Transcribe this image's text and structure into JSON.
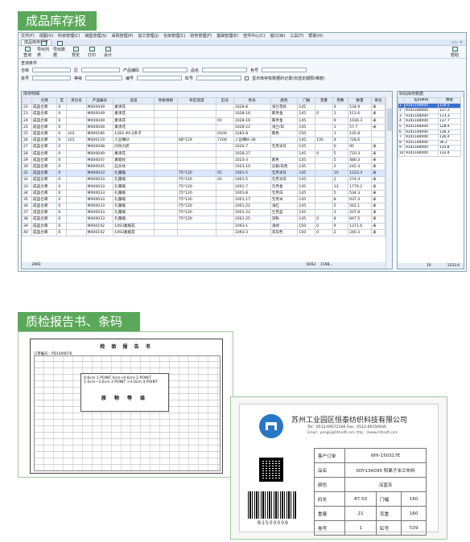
{
  "section1_title": "成品库存报表",
  "section2_title": "质检报告书、条码标签",
  "app": {
    "menu": [
      "文件(F)",
      "视图(V)",
      "科目管理(C)",
      "销售管理(S)",
      "采购管理(P)",
      "加工管理(J)",
      "仓库管理(C)",
      "财务管理(F)",
      "基础管理(E)",
      "控件中心(C)",
      "窗口(W)",
      "工具(T)",
      "帮助(H)"
    ],
    "tab": "成品库存报表",
    "tab_right": "◁ ▷ ✕",
    "toolbar": [
      "查询",
      "导出列表",
      "导出数据",
      "预览",
      "打印",
      "设计"
    ],
    "help_label": "帮助",
    "filter_group": "查询条件",
    "filters": {
      "warehouse": "仓库",
      "zone": "区",
      "product": "产品编码",
      "name": "品名",
      "color_no": "色号",
      "lot": "批号",
      "grade": "等级",
      "serial": "编号",
      "vat": "缸号",
      "checkbox": "显示库存有数据的记录(仅选定期限/维度)"
    },
    "grid_title": "库存明细",
    "side_title": "缸码库存数据"
  },
  "grid": {
    "columns": [
      "",
      "仓库",
      "区",
      "货位号",
      "产品编号",
      "品名",
      "色板规格",
      "布匹宽度",
      "缸号",
      "色号",
      "颜色",
      "门幅",
      "克重",
      "卷数",
      "数量",
      "单位"
    ],
    "rows": [
      [
        "22",
        "成品仓库",
        "0",
        "",
        "M000049",
        "素涤花",
        "",
        "",
        "",
        "1028-8",
        "浅兰花纹",
        "145",
        "",
        "4",
        "534.9",
        "米"
      ],
      [
        "23",
        "成品仓库",
        "0",
        "",
        "M000049",
        "素涤花",
        "",
        "",
        "",
        "1028-16",
        "黄月金",
        "145",
        "0",
        "1",
        "113.6",
        "米"
      ],
      [
        "24",
        "成品仓库",
        "0",
        "",
        "M000049",
        "素涤花",
        "",
        "",
        "01",
        "1028-16",
        "黄月金",
        "145",
        "",
        "9",
        "1036.3",
        "米"
      ],
      [
        "25",
        "成品仓库",
        "0",
        "",
        "M000049",
        "素涤花",
        "",
        "",
        "",
        "1028-22",
        "浅兰/白",
        "145",
        "",
        "1",
        "57.7",
        "米"
      ],
      [
        "25",
        "成品仓库",
        "0",
        "L01",
        "M000186",
        "1283 #0.2条子",
        "",
        "",
        "0100",
        "1283-8",
        "黄色",
        "150",
        "",
        "1",
        "135.8",
        ""
      ],
      [
        "26",
        "成品仓库",
        "0",
        "L01",
        "M000119",
        "人丝细纱",
        "",
        "68*129",
        "7200",
        "人丝细纱-36",
        "",
        "145",
        "130",
        "4",
        "728.6",
        ""
      ],
      [
        "27",
        "成品仓库",
        "0",
        "",
        "M000048",
        "凸纹力织",
        "",
        "",
        "",
        "1026-7",
        "元月冰灰",
        "145",
        "",
        "0",
        "95",
        "米"
      ],
      [
        "28",
        "成品仓库",
        "0",
        "",
        "M000049",
        "素涤花",
        "",
        "",
        "",
        "1028-27",
        "",
        "145",
        "0",
        "5",
        "710.3",
        "米"
      ],
      [
        "29",
        "成品仓库",
        "0",
        "",
        "M000047",
        "素缎纹",
        "",
        "",
        "",
        "1023-3",
        "紫色",
        "145",
        "",
        "5",
        "480.3",
        "米"
      ],
      [
        "30",
        "成品仓库",
        "0",
        "",
        "M000045",
        "石头纹",
        "",
        "",
        "",
        "1023-10",
        "淡紫/白色",
        "145",
        "",
        "2",
        "242.4",
        "米"
      ],
      [
        "31",
        "成品仓库",
        "0",
        "",
        "M000033",
        "礼服缎",
        "",
        "75*120",
        "01",
        "1001-5",
        "元月冰灰",
        "145",
        "",
        "10",
        "1233.4",
        "米"
      ],
      [
        "32",
        "成品仓库",
        "0",
        "",
        "M000033",
        "礼服缎",
        "",
        "75*120",
        "02",
        "1001-5",
        "元月冰灰",
        "145",
        "",
        "2",
        "274.4",
        "米"
      ],
      [
        "33",
        "成品仓库",
        "0",
        "",
        "M000033",
        "礼服缎",
        "",
        "75*120",
        "",
        "1001-7",
        "元月金",
        "145",
        "",
        "13",
        "1770.2",
        "米"
      ],
      [
        "34",
        "成品仓库",
        "0",
        "",
        "M000033",
        "礼服缎",
        "",
        "75*120",
        "",
        "1001-8",
        "元月白",
        "145",
        "",
        "5",
        "534.3",
        "米"
      ],
      [
        "35",
        "成品仓库",
        "0",
        "",
        "M000033",
        "礼服缎",
        "",
        "75*120",
        "",
        "1001-17",
        "元月米",
        "145",
        "",
        "8",
        "937.4",
        "米"
      ],
      [
        "36",
        "成品仓库",
        "0",
        "",
        "M000033",
        "礼服缎",
        "",
        "75*120",
        "",
        "1001-21",
        "浅红",
        "145",
        "",
        "5",
        "562.1",
        "米"
      ],
      [
        "37",
        "成品仓库",
        "0",
        "",
        "M000033",
        "礼服缎",
        "",
        "75*120",
        "",
        "1001-22",
        "兰月蓝",
        "145",
        "",
        "3",
        "207.8",
        "米"
      ],
      [
        "38",
        "成品仓库",
        "0",
        "",
        "M000033",
        "礼服缎",
        "",
        "75*120",
        "",
        "1001-25",
        "深粉",
        "145",
        "0",
        "8",
        "847.5",
        "米"
      ],
      [
        "39",
        "成品仓库",
        "0",
        "",
        "M000192",
        "1093素缎花",
        "",
        "",
        "",
        "1093-1",
        "浅绿",
        "150",
        "0",
        "9",
        "1371.6",
        "米"
      ],
      [
        "40",
        "成品仓库",
        "0",
        "",
        "M000192",
        "1093素缎花",
        "",
        "",
        "",
        "1093-3",
        "深灰色",
        "150",
        "0",
        "2",
        "240.3",
        "米"
      ]
    ],
    "footer_count": "2993",
    "footer_rolls": "8163",
    "footer_qty": "1198..."
  },
  "side": {
    "columns": [
      "",
      "缸码条码",
      "数量"
    ],
    "rows": [
      [
        "1",
        "9141199000",
        "136.5"
      ],
      [
        "2",
        "9141184000",
        "137.2"
      ],
      [
        "3",
        "9141184000",
        "113.3"
      ],
      [
        "4",
        "9141184000",
        "137.7"
      ],
      [
        "5",
        "9141184000",
        "128.4"
      ],
      [
        "6",
        "9141184000",
        "136.3"
      ],
      [
        "7",
        "9141184000",
        "136.4"
      ],
      [
        "8",
        "9141184000",
        "36.2"
      ],
      [
        "9",
        "9141184000",
        "135.8"
      ],
      [
        "10",
        "9141184000",
        "132.4"
      ]
    ],
    "footer_count": "10",
    "footer_qty": "1233.4"
  },
  "report": {
    "title": "检 验 报 告 书",
    "head": "订单编号：PD1400076",
    "mid_line1": "0.6cm 1 POINT    0cm+0.6cm 2 POINT",
    "mid_line2": "1.5cm~3.0cm 3 POINT    >3.0cm 4 POINT",
    "mid_title": "原 物 等 级"
  },
  "label": {
    "company": "苏州工业园区恒泰纺织科技有限公司",
    "tel": "Tel：0512-69572166    Fax：0512-69150936",
    "email": "Email：pengkj@hthsoft.com    http：//www.hthsoft.com",
    "rows": [
      [
        "客户订单",
        "WH-150317E",
        "",
        ""
      ],
      [
        "品名",
        "XDY13A095  阳离子米兰布料",
        "",
        ""
      ],
      [
        "颜色",
        "深蓝灰",
        "",
        ""
      ],
      [
        "码长",
        "87.50",
        "门幅",
        "160"
      ],
      [
        "重量",
        "21",
        "克重",
        "160"
      ],
      [
        "卷号",
        "1",
        "缸号",
        "539"
      ]
    ],
    "barcode_text": "B1500009"
  }
}
